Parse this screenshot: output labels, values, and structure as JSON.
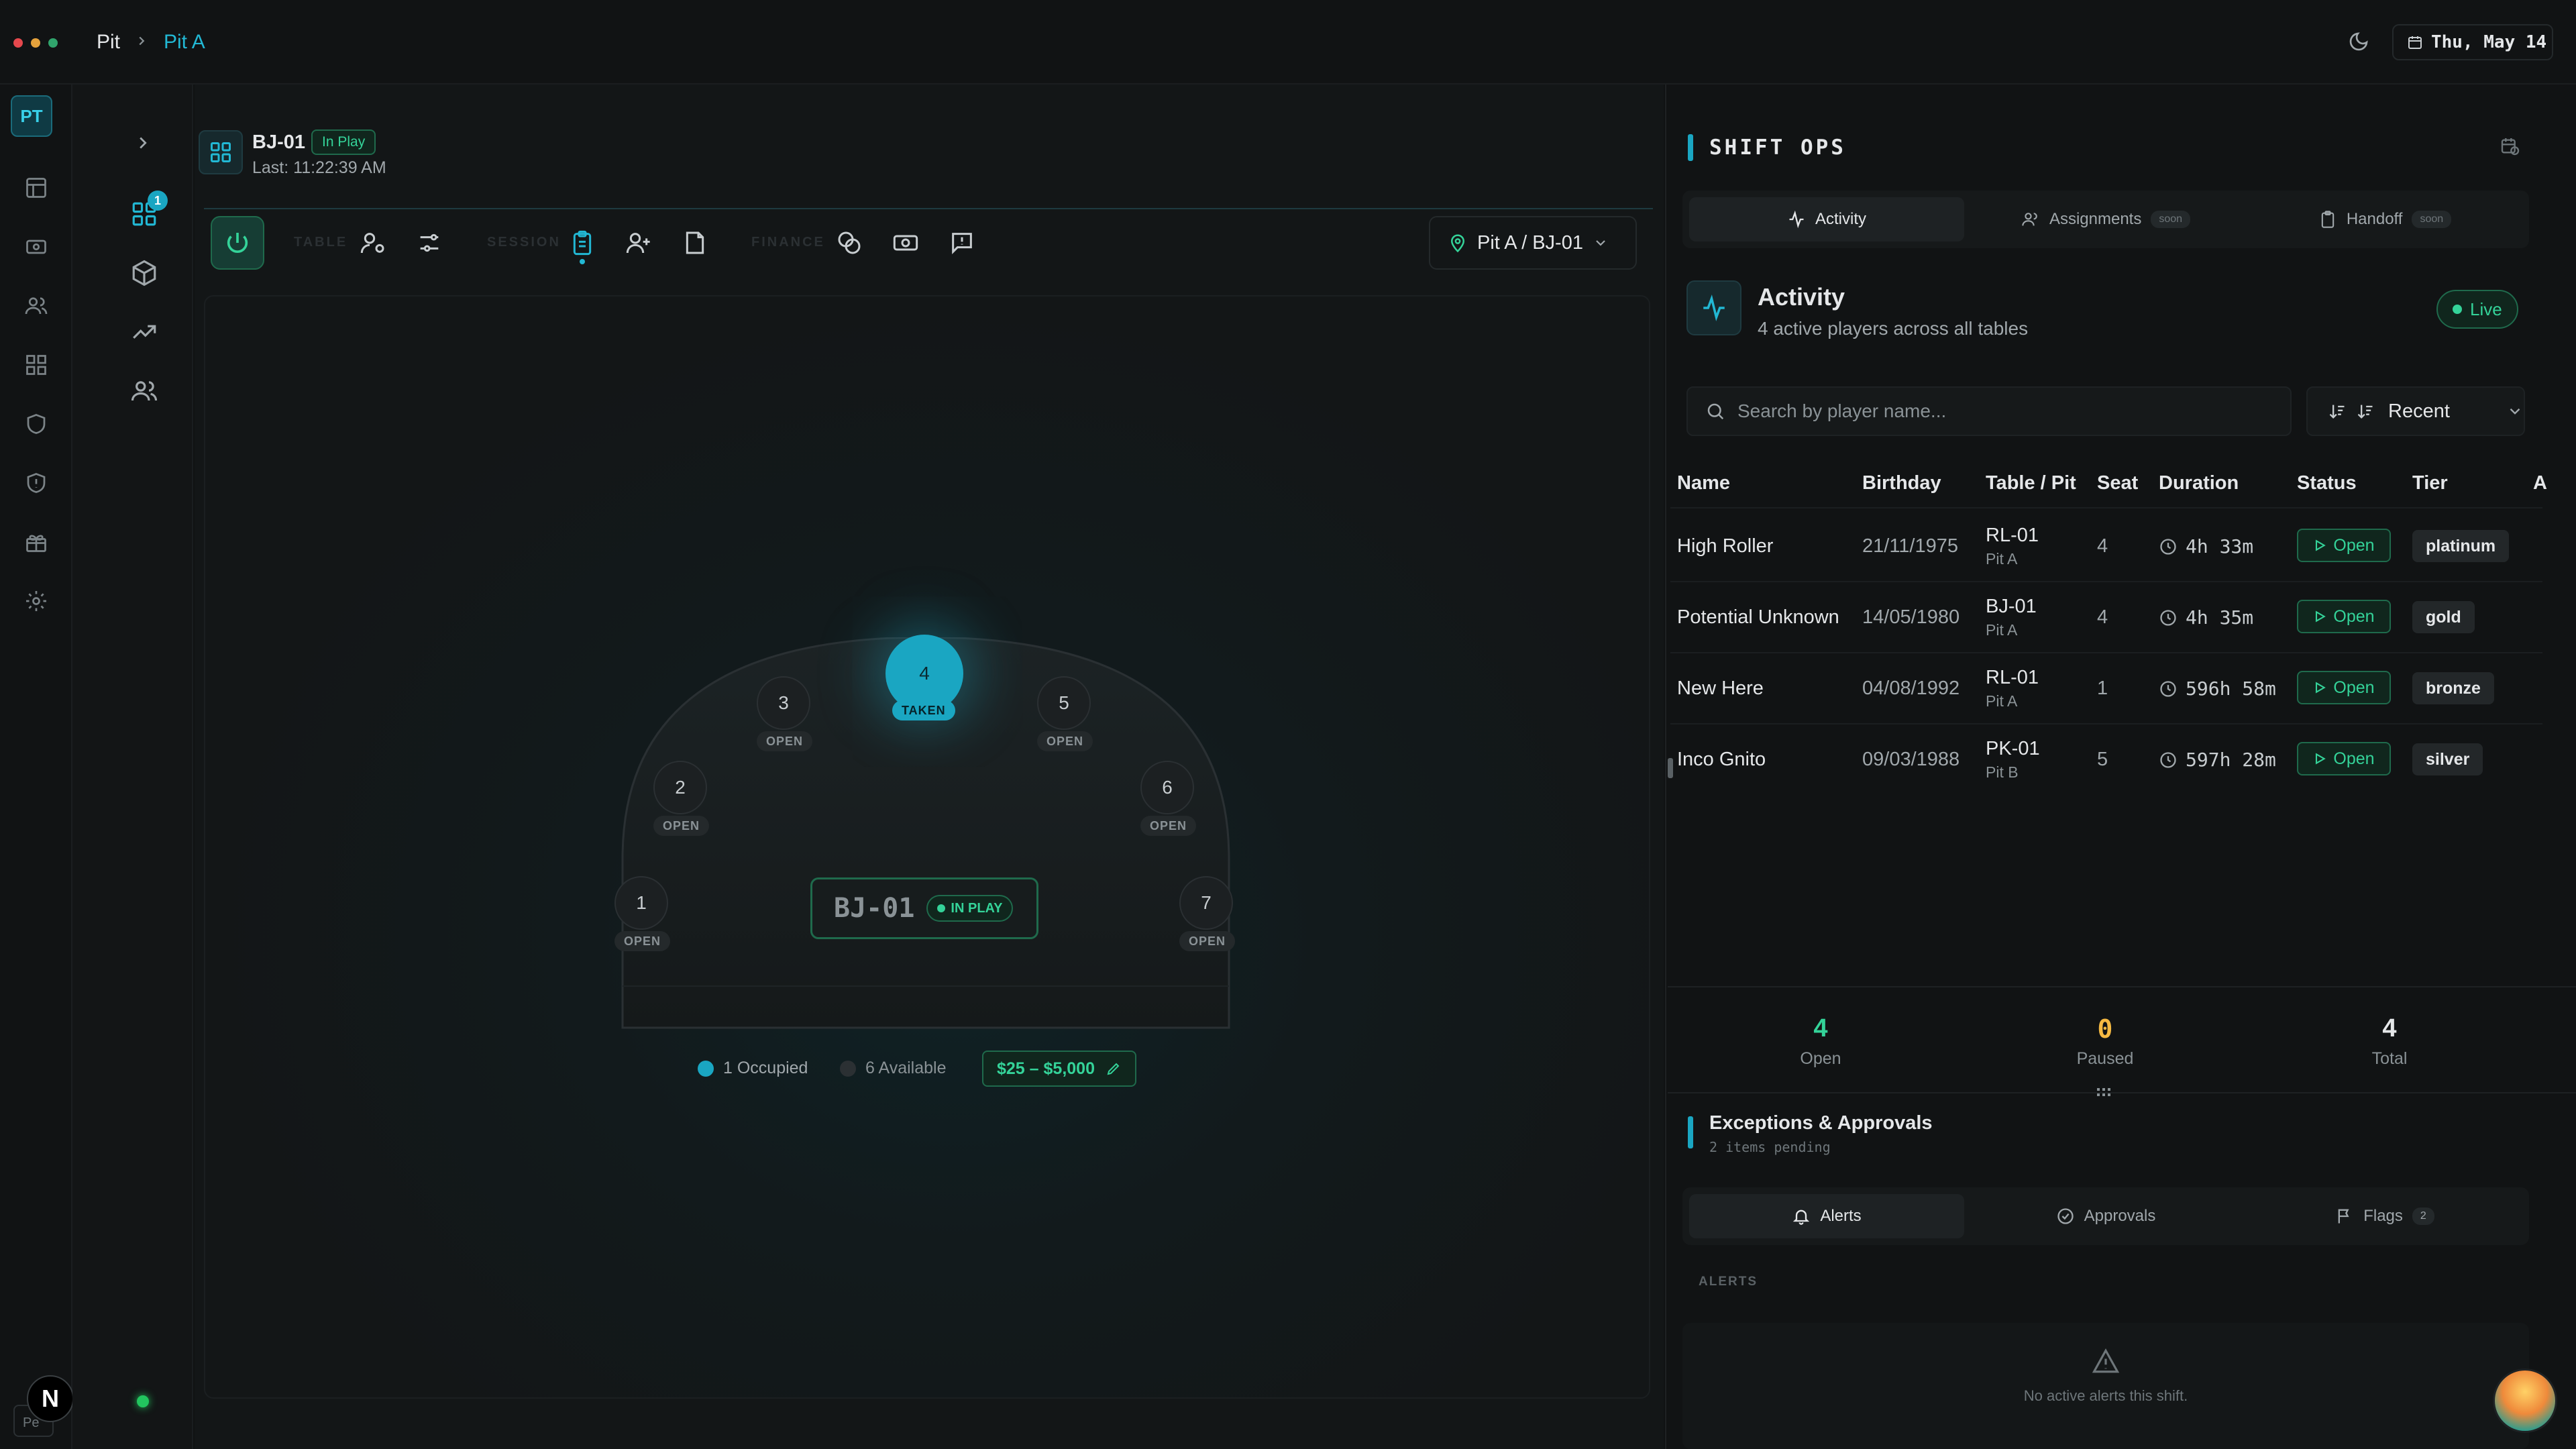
{
  "topbar": {
    "breadcrumb_root": "Pit",
    "breadcrumb_current": "Pit A",
    "date": "Thu, May 14"
  },
  "rail": {
    "avatar": "PT",
    "bottom_badge": "N",
    "bottom_label": "Pe"
  },
  "subrail": {
    "badge": "1"
  },
  "table_header": {
    "name": "BJ-01",
    "status": "In Play",
    "last": "Last: 11:22:39 AM"
  },
  "toolbar": {
    "groups": [
      "TABLE",
      "SESSION",
      "FINANCE"
    ],
    "location": "Pit A / BJ-01"
  },
  "stage": {
    "table_label": "BJ-01",
    "table_status": "IN PLAY",
    "seats": [
      {
        "num": "1",
        "tag": "OPEN"
      },
      {
        "num": "2",
        "tag": "OPEN"
      },
      {
        "num": "3",
        "tag": "OPEN"
      },
      {
        "num": "4",
        "tag": "TAKEN"
      },
      {
        "num": "5",
        "tag": "OPEN"
      },
      {
        "num": "6",
        "tag": "OPEN"
      },
      {
        "num": "7",
        "tag": "OPEN"
      }
    ],
    "occupied": "1 Occupied",
    "available": "6 Available",
    "limits": "$25 – $5,000"
  },
  "panel": {
    "title": "SHIFT OPS",
    "tabs": [
      {
        "label": "Activity"
      },
      {
        "label": "Assignments",
        "badge": "soon"
      },
      {
        "label": "Handoff",
        "badge": "soon"
      }
    ],
    "activity_title": "Activity",
    "activity_subtitle": "4 active players across all tables",
    "live": "Live",
    "search_placeholder": "Search by player name...",
    "sort": "Recent",
    "columns": [
      "Name",
      "Birthday",
      "Table / Pit",
      "Seat",
      "Duration",
      "Status",
      "Tier",
      "A"
    ],
    "rows": [
      {
        "name": "High Roller",
        "birthday": "21/11/1975",
        "table": "RL-01",
        "pit": "Pit A",
        "seat": "4",
        "duration": "4h 33m",
        "status": "Open",
        "tier": "platinum"
      },
      {
        "name": "Potential Unknown",
        "birthday": "14/05/1980",
        "table": "BJ-01",
        "pit": "Pit A",
        "seat": "4",
        "duration": "4h 35m",
        "status": "Open",
        "tier": "gold"
      },
      {
        "name": "New Here",
        "birthday": "04/08/1992",
        "table": "RL-01",
        "pit": "Pit A",
        "seat": "1",
        "duration": "596h 58m",
        "status": "Open",
        "tier": "bronze"
      },
      {
        "name": "Inco Gnito",
        "birthday": "09/03/1988",
        "table": "PK-01",
        "pit": "Pit B",
        "seat": "5",
        "duration": "597h 28m",
        "status": "Open",
        "tier": "silver"
      }
    ],
    "stats": [
      {
        "value": "4",
        "label": "Open",
        "color": "#34d399"
      },
      {
        "value": "0",
        "label": "Paused",
        "color": "#f5b942"
      },
      {
        "value": "4",
        "label": "Total",
        "color": "#e5e7e9"
      }
    ],
    "exceptions_title": "Exceptions & Approvals",
    "exceptions_sub": "2 items pending",
    "ex_tabs": [
      {
        "label": "Alerts"
      },
      {
        "label": "Approvals"
      },
      {
        "label": "Flags",
        "badge": "2"
      }
    ],
    "alerts_heading": "ALERTS",
    "no_alerts": "No active alerts this shift."
  },
  "colors": {
    "accent": "#22b8d4",
    "success": "#34d399",
    "warning": "#f5b942",
    "bg": "#101213"
  }
}
